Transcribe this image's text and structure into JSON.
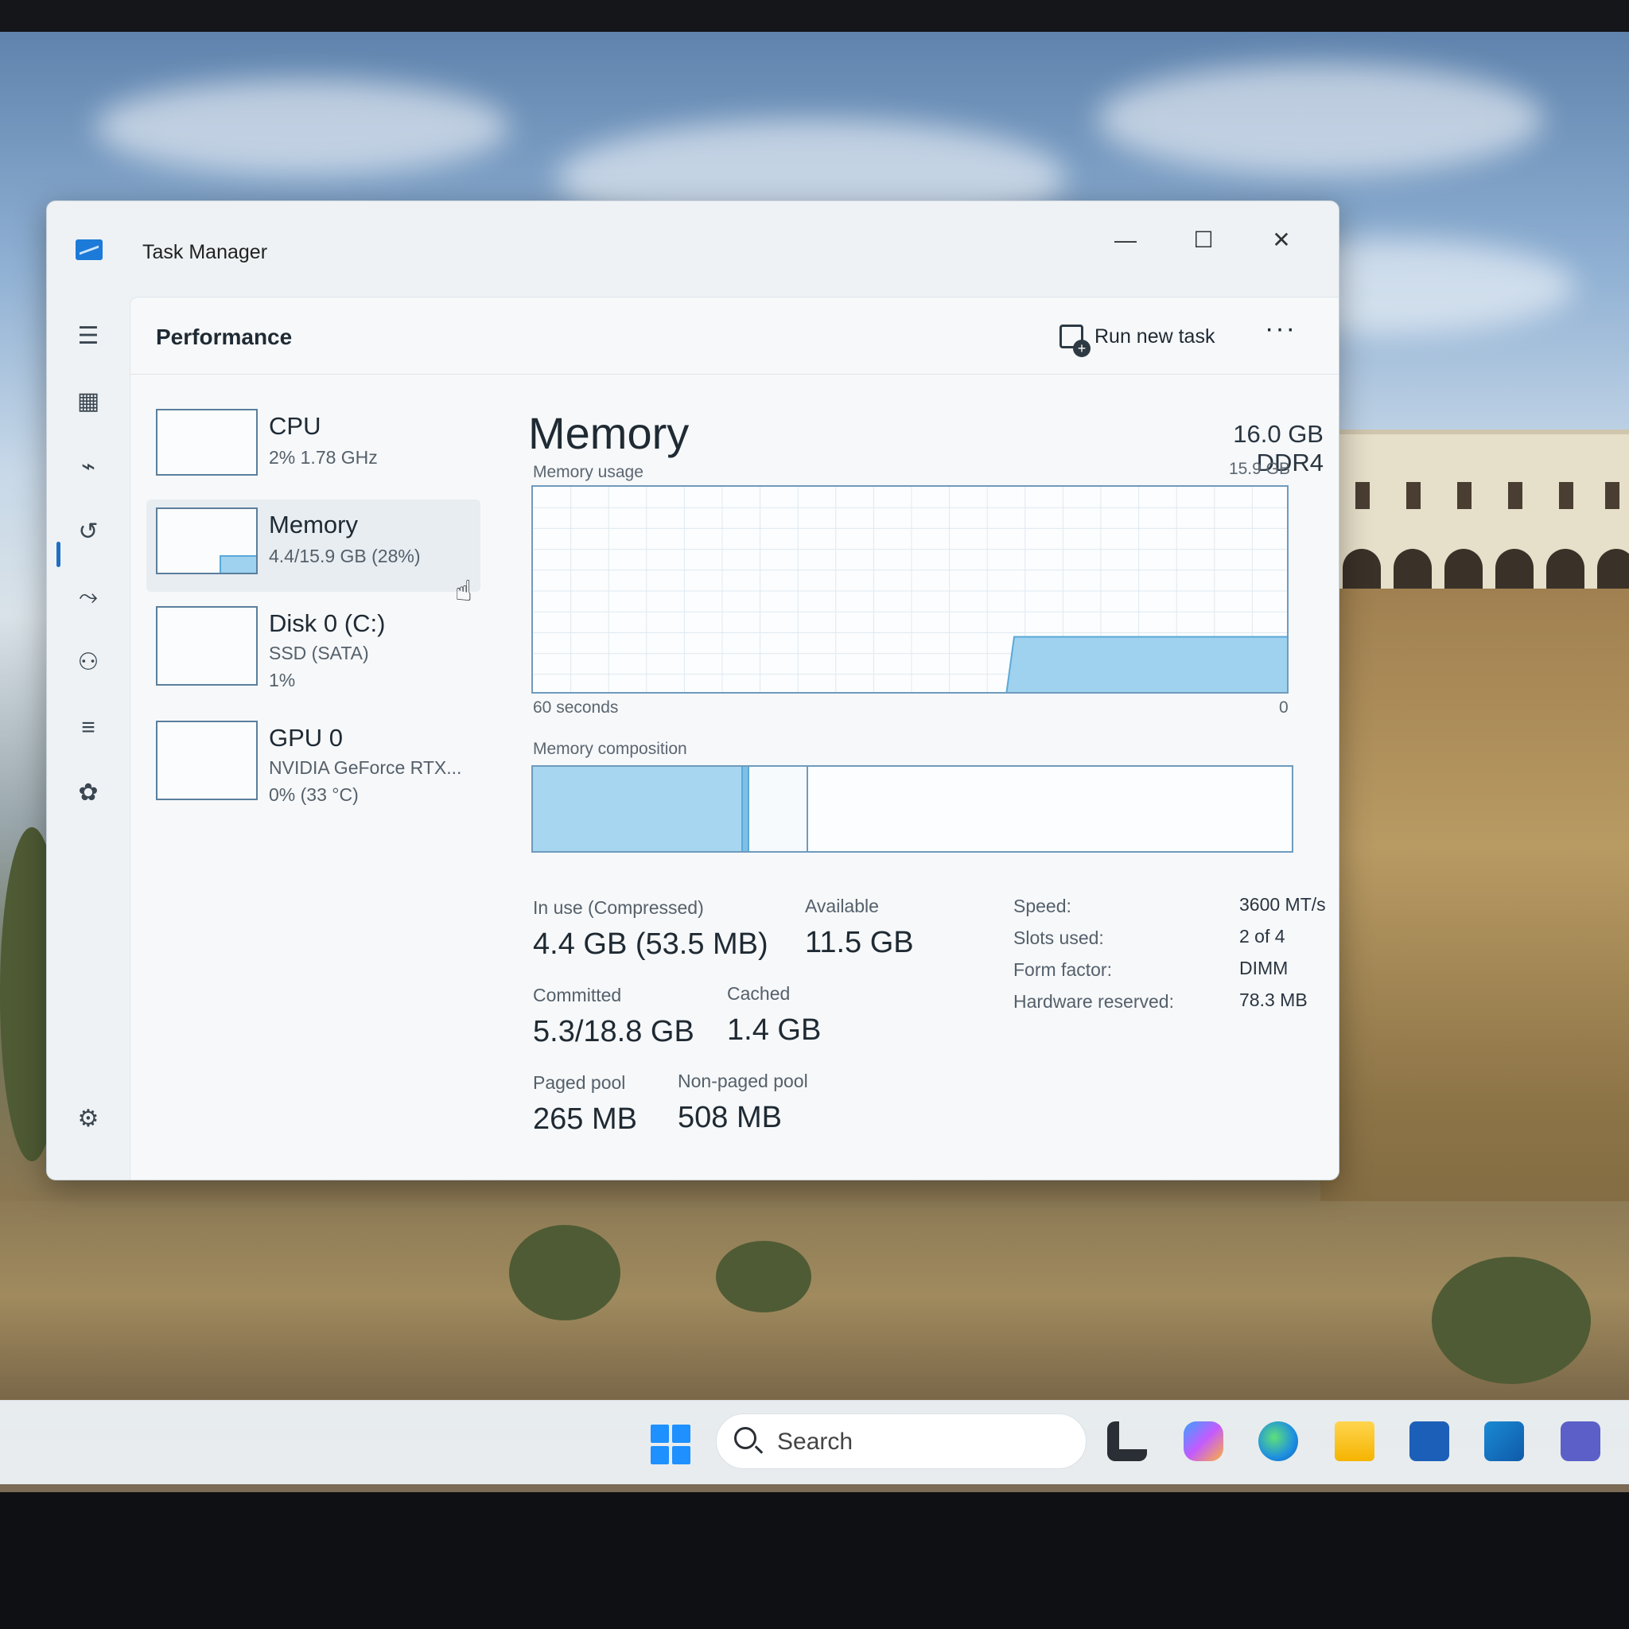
{
  "window": {
    "title": "Task Manager",
    "minimize_glyph": "—",
    "maximize_glyph": "☐",
    "close_glyph": "✕"
  },
  "nav": {
    "icons": [
      "menu-icon",
      "processes-icon",
      "performance-icon",
      "app-history-icon",
      "startup-apps-icon",
      "users-icon",
      "details-icon",
      "services-icon",
      "settings-icon"
    ]
  },
  "header": {
    "page_title": "Performance",
    "run_task_label": "Run new task",
    "more_label": "···"
  },
  "devices": [
    {
      "name": "CPU",
      "line1": "2%  1.78 GHz",
      "line2": ""
    },
    {
      "name": "Memory",
      "line1": "4.4/15.9 GB (28%)",
      "line2": ""
    },
    {
      "name": "Disk 0 (C:)",
      "line1": "SSD (SATA)",
      "line2": "1%"
    },
    {
      "name": "GPU 0",
      "line1": "NVIDIA GeForce RTX...",
      "line2": "0%  (33 °C)"
    }
  ],
  "memory": {
    "title": "Memory",
    "spec": "16.0 GB DDR4",
    "usage_label": "Memory usage",
    "usage_max": "15.9 GB",
    "time_label": "60 seconds",
    "time_zero": "0",
    "composition_label": "Memory composition",
    "stats": {
      "in_use_label": "In use (Compressed)",
      "in_use_value": "4.4 GB (53.5 MB)",
      "available_label": "Available",
      "available_value": "11.5 GB",
      "committed_label": "Committed",
      "committed_value": "5.3/18.8 GB",
      "cached_label": "Cached",
      "cached_value": "1.4 GB",
      "paged_label": "Paged pool",
      "paged_value": "265 MB",
      "nonpaged_label": "Non-paged pool",
      "nonpaged_value": "508 MB"
    },
    "specs": {
      "speed_label": "Speed:",
      "speed_value": "3600 MT/s",
      "slots_label": "Slots used:",
      "slots_value": "2 of 4",
      "form_label": "Form factor:",
      "form_value": "DIMM",
      "hw_label": "Hardware reserved:",
      "hw_value": "78.3 MB"
    },
    "usage_fraction": 0.28
  },
  "taskbar": {
    "search_placeholder": "Search",
    "icons": [
      "start-icon",
      "task-view-icon",
      "copilot-icon",
      "edge-icon",
      "file-explorer-icon",
      "store-icon",
      "outlook-icon",
      "teams-icon"
    ]
  },
  "colors": {
    "accent": "#1f6fc2",
    "graph_fill": "#9fd2ef",
    "graph_line": "#5aa9d8"
  }
}
